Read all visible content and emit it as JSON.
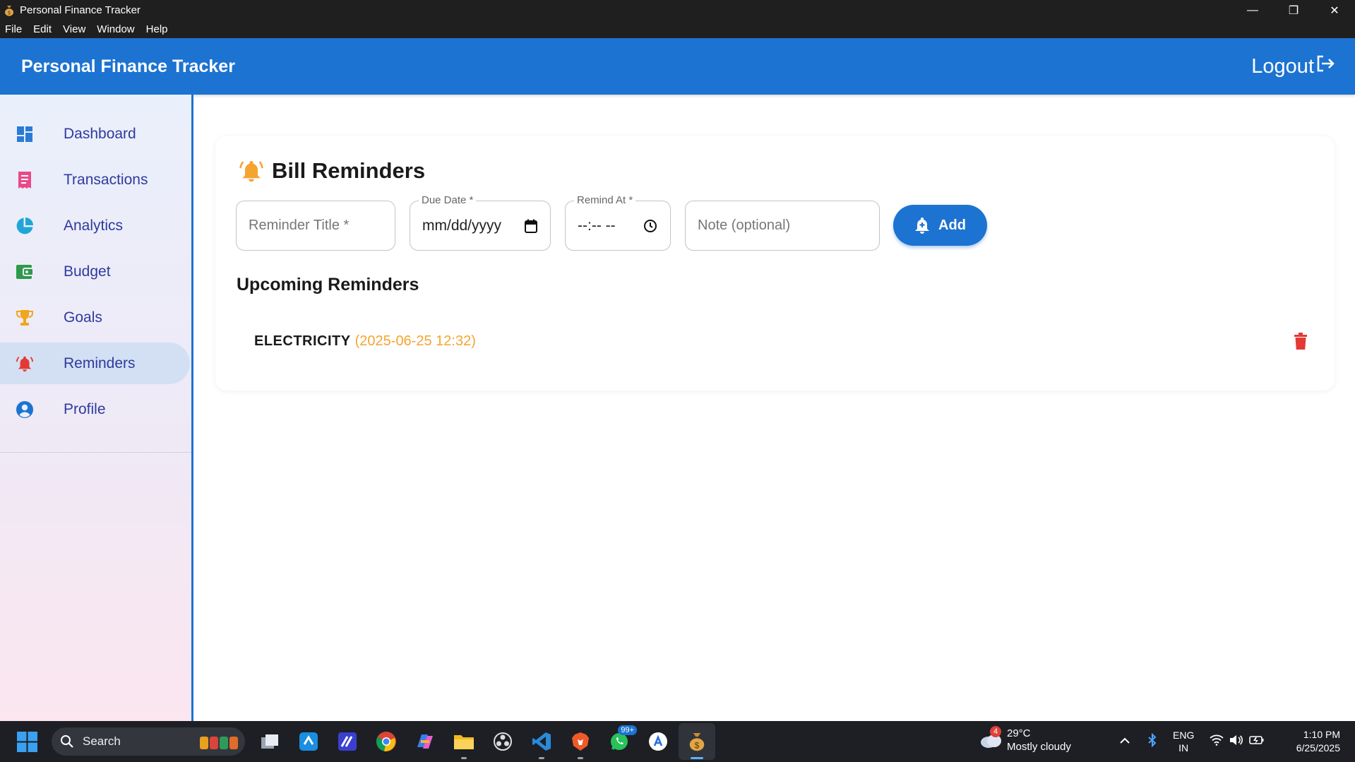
{
  "window": {
    "title": "Personal Finance Tracker",
    "minimize": "—",
    "maximize": "❐",
    "close": "✕"
  },
  "menu": [
    "File",
    "Edit",
    "View",
    "Window",
    "Help"
  ],
  "header": {
    "brand": "Personal Finance Tracker",
    "logout": "Logout"
  },
  "sidebar": {
    "items": [
      {
        "label": "Dashboard",
        "icon": "dashboard-icon"
      },
      {
        "label": "Transactions",
        "icon": "receipt-icon"
      },
      {
        "label": "Analytics",
        "icon": "pie-chart-icon"
      },
      {
        "label": "Budget",
        "icon": "wallet-icon"
      },
      {
        "label": "Goals",
        "icon": "trophy-icon"
      },
      {
        "label": "Reminders",
        "icon": "bell-icon",
        "active": true
      },
      {
        "label": "Profile",
        "icon": "account-icon"
      }
    ]
  },
  "main": {
    "title": "Bill Reminders",
    "form": {
      "title_placeholder": "Reminder Title *",
      "due_date_label": "Due Date *",
      "due_date_value": "mm/dd/yyyy",
      "remind_at_label": "Remind At *",
      "remind_at_value": "--:-- --",
      "note_placeholder": "Note (optional)",
      "add_label": "Add"
    },
    "upcoming_title": "Upcoming Reminders",
    "reminders": [
      {
        "name": "ELECTRICITY",
        "when": "(2025-06-25 12:32)"
      }
    ]
  },
  "taskbar": {
    "search": "Search",
    "weather": {
      "temp": "29°C",
      "desc": "Mostly cloudy",
      "badge": "4"
    },
    "whatsapp_badge": "99+",
    "lang": {
      "line1": "ENG",
      "line2": "IN"
    },
    "time": "1:10 PM",
    "date": "6/25/2025"
  },
  "colors": {
    "primary": "#1c73d1",
    "date_text": "#f5a430",
    "delete": "#e53935"
  }
}
